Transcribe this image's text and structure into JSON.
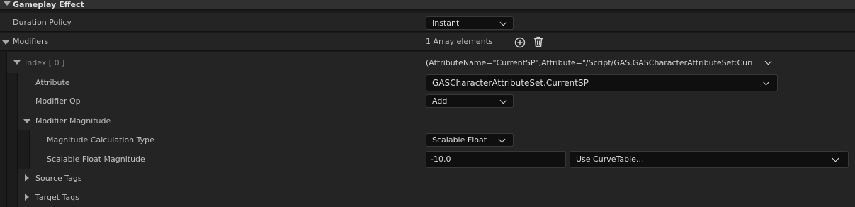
{
  "section": {
    "title": "Gameplay Effect"
  },
  "duration_policy": {
    "label": "Duration Policy",
    "value": "Instant"
  },
  "modifiers": {
    "label": "Modifiers",
    "count_text": "1 Array elements"
  },
  "index_row": {
    "label": "Index [ 0 ]",
    "value": "(AttributeName=\"CurrentSP\",Attribute=\"/Script/GAS.GASCharacterAttributeSet:CurrentSP\",A"
  },
  "attribute": {
    "label": "Attribute",
    "value": "GASCharacterAttributeSet.CurrentSP"
  },
  "modifier_op": {
    "label": "Modifier Op",
    "value": "Add"
  },
  "modifier_magnitude": {
    "label": "Modifier Magnitude"
  },
  "magnitude_calc_type": {
    "label": "Magnitude Calculation Type",
    "value": "Scalable Float"
  },
  "scalable_float": {
    "label": "Scalable Float Magnitude",
    "value": "-10.0",
    "curve_value": "Use CurveTable..."
  },
  "source_tags": {
    "label": "Source Tags"
  },
  "target_tags": {
    "label": "Target Tags"
  },
  "icons": {
    "add": "plus-circle-icon",
    "delete": "trash-icon",
    "expand": "triangle-down-icon",
    "collapse": "triangle-right-icon"
  }
}
